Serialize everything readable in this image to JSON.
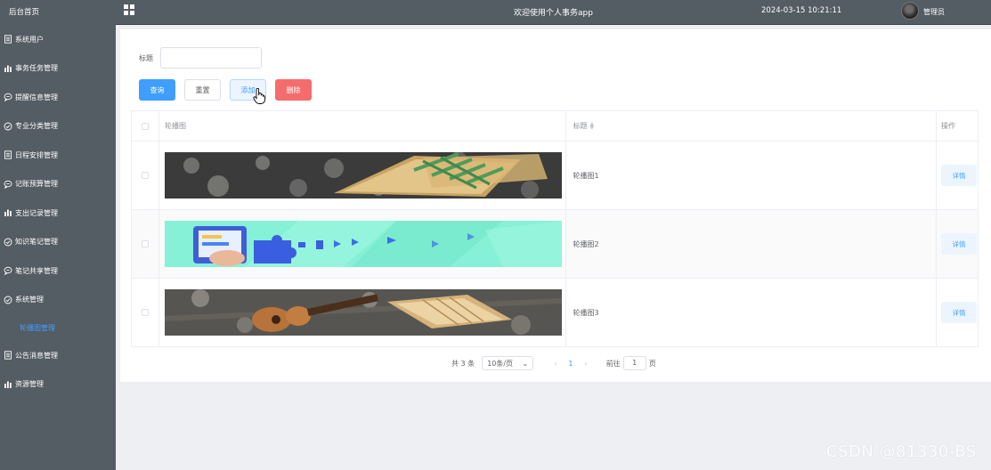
{
  "sidebar": {
    "home": "后台首页",
    "items": [
      {
        "label": "系统用户",
        "icon": "document-icon"
      },
      {
        "label": "事务任务管理",
        "icon": "bar-chart-icon"
      },
      {
        "label": "提醒信息管理",
        "icon": "chat-bubble-icon"
      },
      {
        "label": "专业分类管理",
        "icon": "circle-check-icon"
      },
      {
        "label": "日程安排管理",
        "icon": "document-icon"
      },
      {
        "label": "记账预算管理",
        "icon": "chat-bubble-icon"
      },
      {
        "label": "支出记录管理",
        "icon": "bar-chart-icon"
      },
      {
        "label": "知识笔记管理",
        "icon": "circle-check-icon"
      },
      {
        "label": "笔记共享管理",
        "icon": "chat-bubble-icon"
      },
      {
        "label": "系统管理",
        "icon": "circle-check-icon"
      }
    ],
    "sub_item": "轮播图管理",
    "items_after": [
      {
        "label": "公告消息管理",
        "icon": "document-icon"
      },
      {
        "label": "资源管理",
        "icon": "bar-chart-icon"
      }
    ]
  },
  "header": {
    "title": "欢迎使用个人事务app",
    "datetime": "2024-03-15 10:21:11",
    "user": "管理员"
  },
  "search": {
    "label": "标题",
    "value": "",
    "placeholder": ""
  },
  "buttons": {
    "query": "查询",
    "reset": "重置",
    "add": "添加",
    "delete": "删除"
  },
  "table": {
    "headers": {
      "image": "轮播图",
      "title": "标题",
      "action": "操作"
    },
    "rows": [
      {
        "title": "轮播图1",
        "action": "详情"
      },
      {
        "title": "轮播图2",
        "action": "详情"
      },
      {
        "title": "轮播图3",
        "action": "详情"
      }
    ]
  },
  "pagination": {
    "total": "共 3 条",
    "page_size": "10条/页",
    "current": "1",
    "goto_prefix": "前往",
    "goto_value": "1",
    "goto_suffix": "页"
  },
  "watermark": "CSDN @81330-BS",
  "colors": {
    "sidebar_bg": "#545c64",
    "primary": "#409eff",
    "danger": "#f56c6c",
    "content_bg": "#eeeff3"
  }
}
